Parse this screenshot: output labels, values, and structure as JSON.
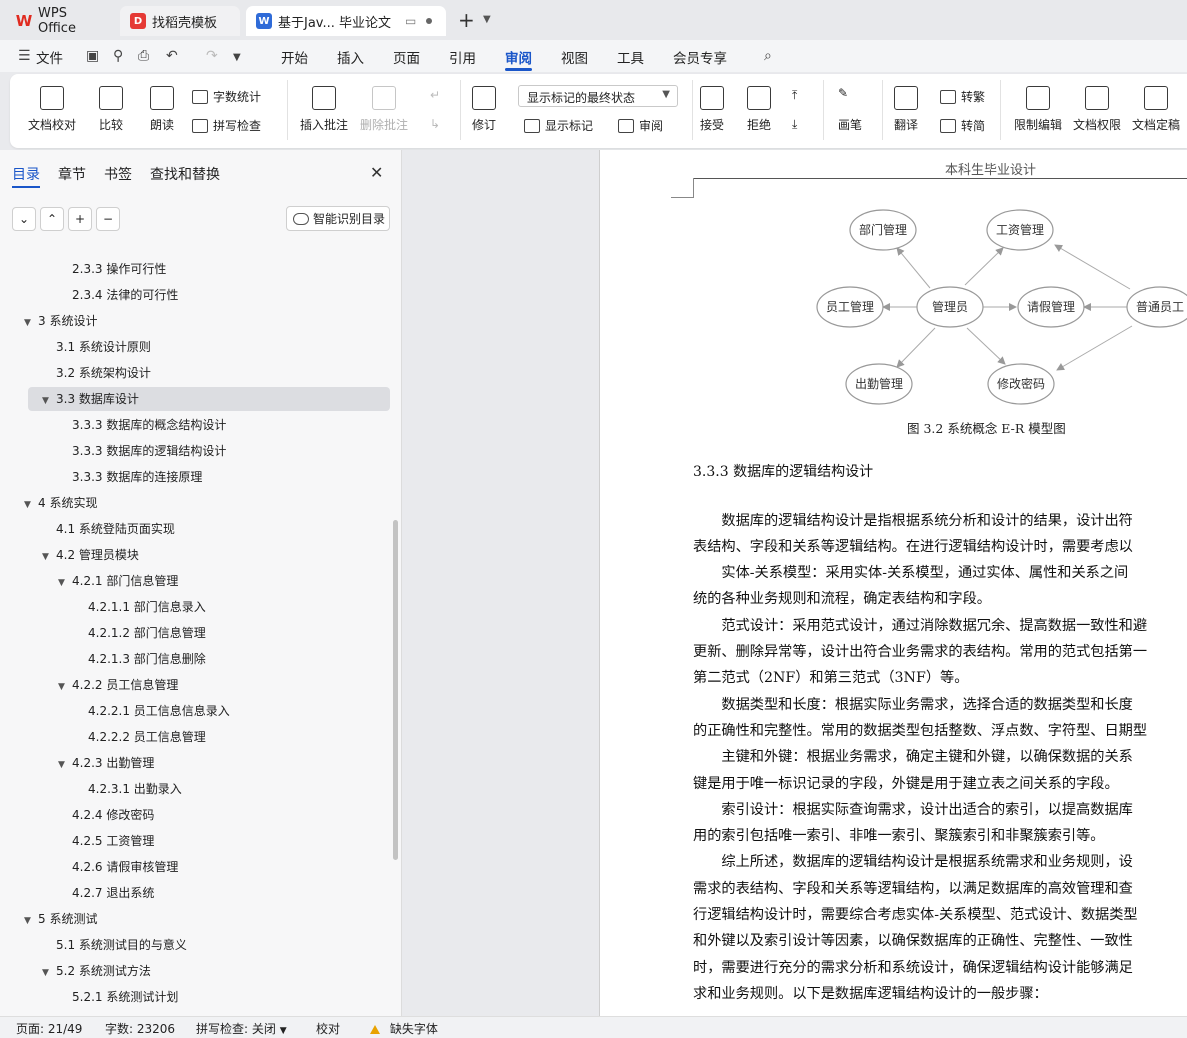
{
  "tabs": [
    {
      "label": "WPS Office",
      "logo": "W"
    },
    {
      "label": "找稻壳模板",
      "logo": "D"
    },
    {
      "label": "基于Jav... 毕业论文",
      "logo": "W"
    }
  ],
  "menu": {
    "file": "文件",
    "items": [
      "开始",
      "插入",
      "页面",
      "引用",
      "审阅",
      "视图",
      "工具",
      "会员专享"
    ],
    "active": "审阅"
  },
  "ribbon": {
    "doc_proof": "文档校对",
    "compare": "比较",
    "read_aloud": "朗读",
    "word_count": "字数统计",
    "spell_check": "拼写检查",
    "insert_comment": "插入批注",
    "delete_comment": "删除批注",
    "revise": "修订",
    "markup_state": "显示标记的最终状态",
    "show_markup": "显示标记",
    "review": "审阅",
    "accept": "接受",
    "reject": "拒绝",
    "pen": "画笔",
    "translate": "翻译",
    "to_traditional": "转繁",
    "to_simplified": "转简",
    "restrict_edit": "限制编辑",
    "doc_permission": "文档权限",
    "doc_finalize": "文档定稿"
  },
  "panel": {
    "tabs": [
      "目录",
      "章节",
      "书签",
      "查找和替换"
    ],
    "smart_toc": "智能识别目录",
    "toc": [
      {
        "text": "2.3.3 操作可行性",
        "level": 3
      },
      {
        "text": "2.3.4 法律的可行性",
        "level": 3
      },
      {
        "text": "3   系统设计",
        "level": 1,
        "expanded": true
      },
      {
        "text": "3.1 系统设计原则",
        "level": 2
      },
      {
        "text": "3.2 系统架构设计",
        "level": 2
      },
      {
        "text": "3.3 数据库设计",
        "level": 2,
        "expanded": true,
        "selected": true
      },
      {
        "text": "3.3.3 数据库的概念结构设计",
        "level": 3
      },
      {
        "text": "3.3.3 数据库的逻辑结构设计",
        "level": 3
      },
      {
        "text": "3.3.3 数据库的连接原理",
        "level": 3
      },
      {
        "text": "4   系统实现",
        "level": 1,
        "expanded": true
      },
      {
        "text": "4.1 系统登陆页面实现",
        "level": 2
      },
      {
        "text": "4.2 管理员模块",
        "level": 2,
        "expanded": true
      },
      {
        "text": "4.2.1 部门信息管理",
        "level": 3,
        "expanded": true
      },
      {
        "text": "4.2.1.1 部门信息录入",
        "level": 4
      },
      {
        "text": "4.2.1.2 部门信息管理",
        "level": 4
      },
      {
        "text": "4.2.1.3 部门信息删除",
        "level": 4
      },
      {
        "text": "4.2.2 员工信息管理",
        "level": 3,
        "expanded": true
      },
      {
        "text": "4.2.2.1 员工信息信息录入",
        "level": 4
      },
      {
        "text": "4.2.2.2 员工信息管理",
        "level": 4
      },
      {
        "text": "4.2.3 出勤管理",
        "level": 3,
        "expanded": true
      },
      {
        "text": "4.2.3.1 出勤录入",
        "level": 4
      },
      {
        "text": "4.2.4 修改密码",
        "level": 3
      },
      {
        "text": "4.2.5 工资管理",
        "level": 3
      },
      {
        "text": "4.2.6 请假审核管理",
        "level": 3
      },
      {
        "text": "4.2.7 退出系统",
        "level": 3
      },
      {
        "text": "5   系统测试",
        "level": 1,
        "expanded": true
      },
      {
        "text": "5.1 系统测试目的与意义",
        "level": 2
      },
      {
        "text": "5.2 系统测试方法",
        "level": 2,
        "expanded": true
      },
      {
        "text": "5.2.1 系统测试计划",
        "level": 3
      }
    ]
  },
  "document": {
    "header": "本科生毕业设计",
    "er_nodes": {
      "dept": "部门管理",
      "salary": "工资管理",
      "emp": "员工管理",
      "admin": "管理员",
      "leave": "请假管理",
      "staff": "普通员工",
      "attend": "出勤管理",
      "pwd": "修改密码"
    },
    "figure_caption": "图 3.2 系统概念 E-R 模型图",
    "section_title": "3.3.3 数据库的逻辑结构设计",
    "lines": [
      "　　数据库的逻辑结构设计是指根据系统分析和设计的结果，设计出符",
      "表结构、字段和关系等逻辑结构。在进行逻辑结构设计时，需要考虑以",
      "　　实体-关系模型：采用实体-关系模型，通过实体、属性和关系之间",
      "统的各种业务规则和流程，确定表结构和字段。",
      "　　范式设计：采用范式设计，通过消除数据冗余、提高数据一致性和避",
      "更新、删除异常等，设计出符合业务需求的表结构。常用的范式包括第一",
      "第二范式（2NF）和第三范式（3NF）等。",
      "　　数据类型和长度：根据实际业务需求，选择合适的数据类型和长度",
      "的正确性和完整性。常用的数据类型包括整数、浮点数、字符型、日期型",
      "　　主键和外键：根据业务需求，确定主键和外键，以确保数据的关系",
      "键是用于唯一标识记录的字段，外键是用于建立表之间关系的字段。",
      "　　索引设计：根据实际查询需求，设计出适合的索引，以提高数据库",
      "用的索引包括唯一索引、非唯一索引、聚簇索引和非聚簇索引等。",
      "　　综上所述，数据库的逻辑结构设计是根据系统需求和业务规则，设",
      "需求的表结构、字段和关系等逻辑结构，以满足数据库的高效管理和查",
      "行逻辑结构设计时，需要综合考虑实体-关系模型、范式设计、数据类型",
      "和外键以及索引设计等因素，以确保数据库的正确性、完整性、一致性",
      "时，需要进行充分的需求分析和系统设计，确保逻辑结构设计能够满足",
      "求和业务规则。以下是数据库逻辑结构设计的一般步骤："
    ]
  },
  "status": {
    "page": "页面: 21/49",
    "words": "字数: 23206",
    "spell": "拼写检查: 关闭",
    "proof": "校对",
    "missing_font": "缺失字体"
  }
}
